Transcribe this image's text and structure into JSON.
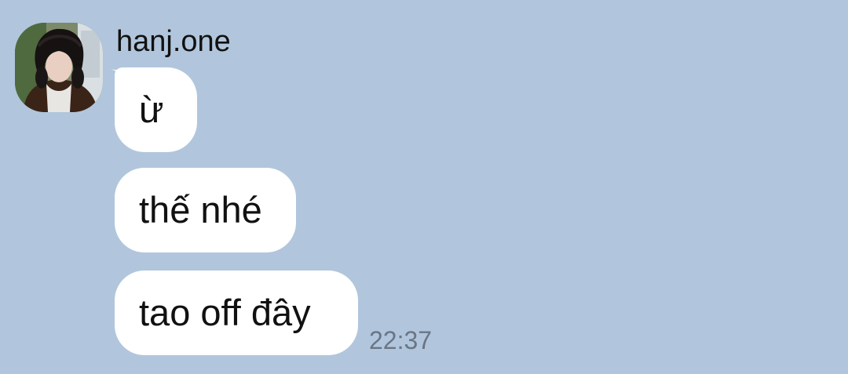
{
  "sender": {
    "name": "hanj.one"
  },
  "messages": [
    {
      "text": "ừ"
    },
    {
      "text": "thế nhé"
    },
    {
      "text": "tao off đây"
    }
  ],
  "last_message_time": "22:37",
  "colors": {
    "background": "#b1c6dc",
    "bubble": "#ffffff",
    "text": "#111111",
    "timestamp": "#6a7585"
  },
  "icons": {
    "avatar": "user-avatar-photo"
  }
}
